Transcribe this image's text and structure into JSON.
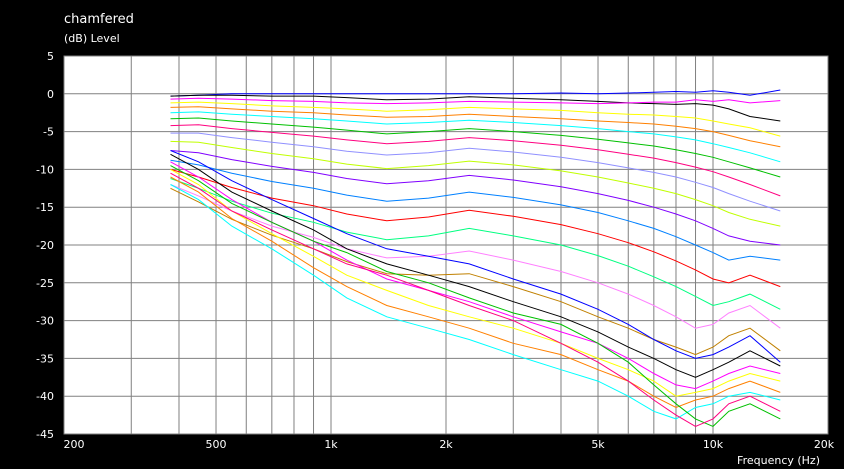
{
  "chart_data": {
    "type": "line",
    "title": "chamfered",
    "ylabel": "(dB)  Level",
    "xlabel": "Frequency  (Hz)",
    "x_scale": "log",
    "xlim": [
      200,
      20000
    ],
    "ylim": [
      -45,
      5
    ],
    "grid": true,
    "x_tick_labels": [
      "200",
      "500",
      "1k",
      "2k",
      "5k",
      "10k",
      "20k"
    ],
    "x_tick_values": [
      200,
      500,
      1000,
      2000,
      5000,
      10000,
      20000
    ],
    "y_ticks": [
      5,
      0,
      -5,
      -10,
      -15,
      -20,
      -25,
      -30,
      -35,
      -40,
      -45
    ],
    "colors": [
      "#0000ff",
      "#000000",
      "#ff00ff",
      "#ffff00",
      "#ff8000",
      "#00ffff",
      "#00c000",
      "#ff0080",
      "#9090ff",
      "#c0ff00",
      "#8000ff",
      "#0080ff",
      "#ff0000",
      "#00ff80",
      "#ff80ff",
      "#c08000"
    ],
    "x": [
      380,
      450,
      550,
      700,
      900,
      1100,
      1400,
      1800,
      2300,
      3000,
      4000,
      5000,
      6000,
      7000,
      8000,
      9000,
      10000,
      11000,
      12500,
      15000
    ],
    "series": [
      {
        "values": [
          -0.3,
          -0.2,
          0,
          0,
          0,
          0,
          0,
          0,
          0,
          0,
          0.1,
          0,
          0.1,
          0.2,
          0.3,
          0.2,
          0.4,
          0.2,
          -0.2,
          0.5
        ]
      },
      {
        "values": [
          -0.3,
          -0.2,
          -0.2,
          -0.3,
          -0.3,
          -0.5,
          -0.8,
          -0.7,
          -0.4,
          -0.6,
          -0.8,
          -1,
          -1.2,
          -1.3,
          -1.4,
          -1.3,
          -1.5,
          -2,
          -3,
          -3.6
        ]
      },
      {
        "values": [
          -0.7,
          -0.6,
          -0.7,
          -0.9,
          -1,
          -1.2,
          -1.3,
          -1.2,
          -1,
          -1.1,
          -1.2,
          -1.3,
          -1.2,
          -1.1,
          -1.1,
          -0.8,
          -1,
          -0.8,
          -1.2,
          -0.9
        ]
      },
      {
        "values": [
          -1.2,
          -1.1,
          -1.3,
          -1.6,
          -1.8,
          -2,
          -2.3,
          -2.1,
          -1.8,
          -2,
          -2.2,
          -2.5,
          -2.7,
          -2.8,
          -3,
          -3.2,
          -3.6,
          -4,
          -4.5,
          -5.6
        ]
      },
      {
        "values": [
          -1.8,
          -1.7,
          -2,
          -2.3,
          -2.5,
          -2.8,
          -3.1,
          -3,
          -2.7,
          -3,
          -3.3,
          -3.6,
          -3.8,
          -4,
          -4.3,
          -4.6,
          -5,
          -5.5,
          -6.2,
          -7
        ]
      },
      {
        "values": [
          -2.5,
          -2.4,
          -2.7,
          -3,
          -3.3,
          -3.6,
          -4,
          -3.8,
          -3.5,
          -3.8,
          -4.2,
          -4.6,
          -5,
          -5.3,
          -5.7,
          -6.1,
          -6.6,
          -7.1,
          -7.8,
          -9
        ]
      },
      {
        "values": [
          -3.3,
          -3.2,
          -3.6,
          -4,
          -4.4,
          -4.8,
          -5.3,
          -5,
          -4.6,
          -5,
          -5.5,
          -6,
          -6.5,
          -6.9,
          -7.4,
          -7.9,
          -8.4,
          -9,
          -9.8,
          -11
        ]
      },
      {
        "values": [
          -4.2,
          -4.1,
          -4.6,
          -5.1,
          -5.6,
          -6.1,
          -6.6,
          -6.3,
          -5.8,
          -6.2,
          -6.8,
          -7.4,
          -8,
          -8.5,
          -9.1,
          -9.7,
          -10.3,
          -11,
          -12,
          -13.5
        ]
      },
      {
        "values": [
          -5.2,
          -5.2,
          -5.8,
          -6.4,
          -7,
          -7.6,
          -8.1,
          -7.8,
          -7.2,
          -7.7,
          -8.4,
          -9.1,
          -9.8,
          -10.4,
          -11,
          -11.7,
          -12.4,
          -13.2,
          -14.2,
          -15.5
        ]
      },
      {
        "values": [
          -6.3,
          -6.4,
          -7.1,
          -7.9,
          -8.6,
          -9.3,
          -9.9,
          -9.5,
          -8.9,
          -9.4,
          -10.2,
          -11,
          -11.8,
          -12.5,
          -13.2,
          -14,
          -14.8,
          -15.7,
          -16.6,
          -17.5
        ]
      },
      {
        "values": [
          -7.5,
          -7.8,
          -8.7,
          -9.6,
          -10.4,
          -11.2,
          -11.9,
          -11.5,
          -10.8,
          -11.4,
          -12.3,
          -13.2,
          -14.1,
          -15,
          -15.9,
          -16.8,
          -17.8,
          -18.8,
          -19.5,
          -20
        ]
      },
      {
        "values": [
          -8.8,
          -9.4,
          -10.5,
          -11.6,
          -12.5,
          -13.4,
          -14.2,
          -13.8,
          -13,
          -13.7,
          -14.7,
          -15.7,
          -16.8,
          -17.8,
          -18.9,
          -20,
          -21,
          -22,
          -21.5,
          -22
        ]
      },
      {
        "values": [
          -10,
          -11,
          -12.4,
          -13.8,
          -14.8,
          -15.9,
          -16.8,
          -16.3,
          -15.4,
          -16.2,
          -17.3,
          -18.5,
          -19.7,
          -20.9,
          -22.1,
          -23.3,
          -24.5,
          -25,
          -24,
          -25.5
        ]
      },
      {
        "values": [
          -11.2,
          -12.5,
          -14.2,
          -15.8,
          -17,
          -18.3,
          -19.3,
          -18.8,
          -17.8,
          -18.8,
          -20,
          -21.4,
          -22.8,
          -24.2,
          -25.5,
          -26.8,
          -28,
          -27.5,
          -26.5,
          -28.5
        ]
      },
      {
        "values": [
          -12,
          -13.5,
          -15.5,
          -17.5,
          -19,
          -20.5,
          -21.7,
          -21.5,
          -20.8,
          -22,
          -23.5,
          -25,
          -26.5,
          -28,
          -29.5,
          -31,
          -30.5,
          -29,
          -28,
          -31
        ]
      },
      {
        "values": [
          -12.5,
          -14.3,
          -16.6,
          -18.7,
          -20.5,
          -22.2,
          -23.8,
          -24,
          -23.8,
          -25.5,
          -27.5,
          -29.5,
          -31,
          -32.5,
          -33.5,
          -34.5,
          -33.5,
          -32,
          -31,
          -34
        ]
      },
      {
        "values": [
          -7.5,
          -9,
          -11.5,
          -14,
          -16.5,
          -18.5,
          -20.5,
          -21.5,
          -22.5,
          -24.5,
          -26.5,
          -28.5,
          -30.5,
          -32.5,
          -34,
          -35,
          -34.5,
          -33.5,
          -32,
          -35.5
        ]
      },
      {
        "values": [
          -8,
          -10,
          -13,
          -15.5,
          -18,
          -20.5,
          -22.5,
          -24,
          -25.5,
          -27.5,
          -29.5,
          -31.5,
          -33.5,
          -35,
          -36.5,
          -37.5,
          -36.5,
          -35.5,
          -34,
          -36
        ]
      },
      {
        "values": [
          -9,
          -11,
          -14,
          -17,
          -19.5,
          -22,
          -24.5,
          -26,
          -27.5,
          -29.5,
          -31.5,
          -33,
          -35,
          -37,
          -38.5,
          -39,
          -38,
          -37,
          -36,
          -37
        ]
      },
      {
        "values": [
          -10,
          -12,
          -15.5,
          -18.5,
          -21.5,
          -24,
          -26,
          -28,
          -29.5,
          -31,
          -33,
          -35,
          -36.5,
          -38,
          -40,
          -39.5,
          -39,
          -38,
          -37,
          -38
        ]
      },
      {
        "values": [
          -11,
          -13,
          -16.5,
          -19.5,
          -23,
          -25.5,
          -28,
          -29.5,
          -31,
          -33,
          -34.5,
          -36.5,
          -38,
          -40,
          -41.5,
          -40.5,
          -40,
          -39,
          -38,
          -39.5
        ]
      },
      {
        "values": [
          -12,
          -14,
          -17.5,
          -20.5,
          -24,
          -27,
          -29.5,
          -31,
          -32.5,
          -34.5,
          -36.5,
          -38,
          -40,
          -42,
          -43,
          -41.5,
          -41,
          -40,
          -39.5,
          -40.5
        ]
      },
      {
        "values": [
          -9.5,
          -11.5,
          -14.5,
          -17,
          -19.5,
          -21,
          -23.5,
          -25,
          -27,
          -29,
          -30.5,
          -33,
          -35.5,
          -38.5,
          -41,
          -43,
          -44,
          -42,
          -41,
          -43
        ]
      },
      {
        "values": [
          -10.5,
          -12.5,
          -15.5,
          -18,
          -20.5,
          -22.5,
          -24,
          -26,
          -28,
          -30,
          -33,
          -35.5,
          -38,
          -40.5,
          -42.5,
          -44,
          -43,
          -41,
          -40,
          -42
        ]
      }
    ]
  }
}
